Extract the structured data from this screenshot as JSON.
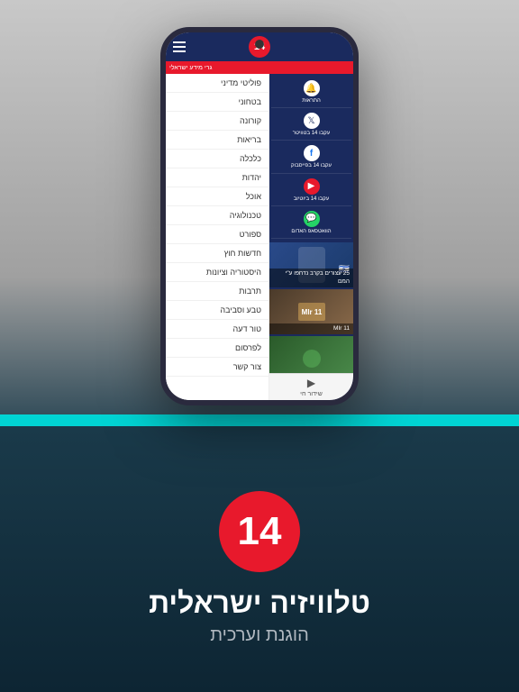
{
  "phone": {
    "header": {
      "logo": "14",
      "hamburger_label": "menu"
    },
    "ticker": {
      "text": "גרי מידע ישראלי"
    },
    "sidebar": {
      "items": [
        {
          "label": "פוליטי מדיני"
        },
        {
          "label": "בטחוני"
        },
        {
          "label": "קורונה"
        },
        {
          "label": "בריאות"
        },
        {
          "label": "כלכלה"
        },
        {
          "label": "יהדות"
        },
        {
          "label": "אוכל"
        },
        {
          "label": "טכנולוגיה"
        },
        {
          "label": "ספורט"
        },
        {
          "label": "חדשות חוץ"
        },
        {
          "label": "היסטוריה וציונות"
        },
        {
          "label": "תרבות"
        },
        {
          "label": "טבע וסביבה"
        },
        {
          "label": "טור דעה"
        },
        {
          "label": "לפרסום"
        },
        {
          "label": "צור קשר"
        }
      ]
    },
    "social": {
      "items": [
        {
          "icon": "🔔",
          "label": "התראות"
        },
        {
          "icon": "𝕏",
          "label": "עקבו 14\nבטוויטר"
        },
        {
          "icon": "f",
          "label": "עקבו 14\nבפייסבוק"
        },
        {
          "icon": "▶",
          "label": "עקבו 14\nביוטיוב"
        },
        {
          "icon": "💬",
          "label": "הוואטסאפ\nהאדום"
        }
      ]
    },
    "news": {
      "items": [
        {
          "text": "25 עצורים בקרב נדחפו ע\"י המם",
          "type": "political"
        },
        {
          "text": "MIr 11",
          "type": "sports"
        },
        {
          "text": "",
          "type": "nature"
        }
      ]
    },
    "bottom_nav": {
      "label": "שידור חי",
      "icon": "▶"
    }
  },
  "bottom": {
    "logo": "14",
    "title": "טלוויזיה ישראלית",
    "subtitle": "הוגנת וערכית"
  }
}
